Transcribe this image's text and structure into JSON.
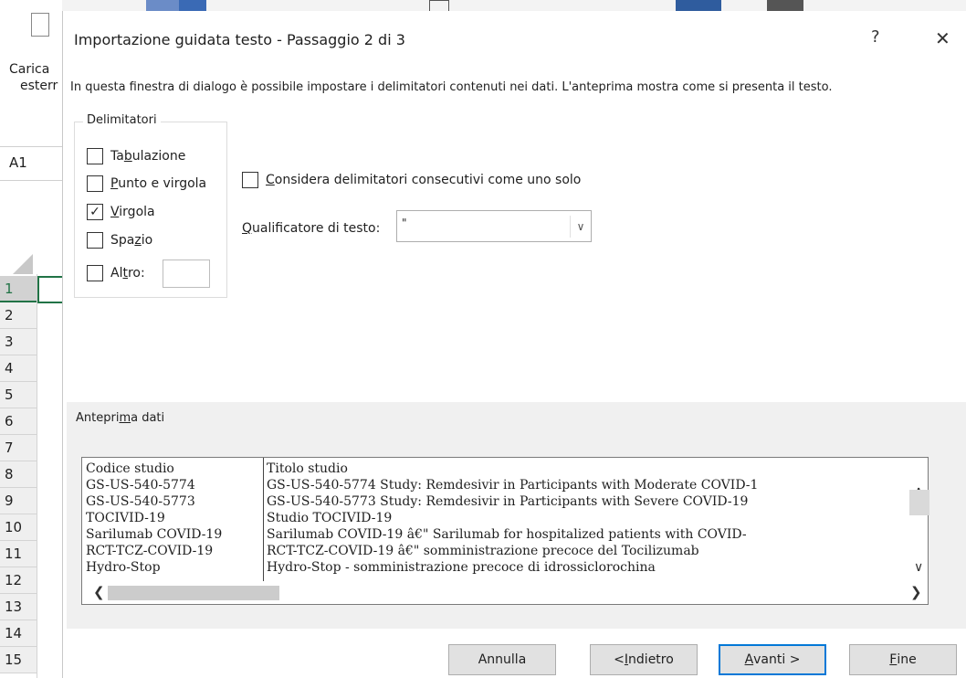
{
  "excel": {
    "left_text_1": "Carica",
    "left_text_2": "esterr",
    "name_box": "A1",
    "rows": [
      "1",
      "2",
      "3",
      "4",
      "5",
      "6",
      "7",
      "8",
      "9",
      "10",
      "11",
      "12",
      "13",
      "14",
      "15"
    ]
  },
  "dialog": {
    "title": "Importazione guidata testo - Passaggio 2 di 3",
    "help_glyph": "?",
    "close_glyph": "✕",
    "description": "In questa finestra di dialogo è possibile impostare i delimitatori contenuti nei dati. L'anteprima mostra come si presenta il testo."
  },
  "delimiters": {
    "legend": "Delimitatori",
    "items": [
      {
        "label_pre": "Ta",
        "label_acc": "b",
        "label_post": "ulazione",
        "checked": false
      },
      {
        "label_pre": "",
        "label_acc": "P",
        "label_post": "unto e virgola",
        "checked": false
      },
      {
        "label_pre": "",
        "label_acc": "V",
        "label_post": "irgola",
        "checked": true
      },
      {
        "label_pre": "Spa",
        "label_acc": "z",
        "label_post": "io",
        "checked": false
      },
      {
        "label_pre": "Al",
        "label_acc": "t",
        "label_post": "ro:",
        "checked": false
      }
    ],
    "altro_value": ""
  },
  "consecutive": {
    "label_acc": "C",
    "label_post": "onsidera delimitatori consecutivi come uno solo",
    "checked": false
  },
  "qualifier": {
    "label_acc": "Q",
    "label_post": "ualificatore di testo:",
    "value": "\""
  },
  "preview": {
    "legend_pre": "Antepri",
    "legend_acc": "m",
    "legend_post": "a dati",
    "rows": [
      {
        "c1": "Codice studio",
        "c2": "Titolo studio"
      },
      {
        "c1": "GS-US-540-5774",
        "c2": "GS-US-540-5774 Study: Remdesivir in Participants with Moderate COVID-1"
      },
      {
        "c1": "GS-US-540-5773",
        "c2": "GS-US-540-5773 Study: Remdesivir in Participants with Severe COVID-19"
      },
      {
        "c1": "TOCIVID-19",
        "c2": "Studio TOCIVID-19"
      },
      {
        "c1": "Sarilumab COVID-19",
        "c2": "Sarilumab COVID-19 â€\" Sarilumab for hospitalized patients with COVID-"
      },
      {
        "c1": "RCT-TCZ-COVID-19",
        "c2": "RCT-TCZ-COVID-19 â€\" somministrazione precoce del Tocilizumab"
      },
      {
        "c1": "Hydro-Stop",
        "c2": "Hydro-Stop - somministrazione precoce di idrossiclorochina"
      }
    ]
  },
  "buttons": {
    "cancel": "Annulla",
    "back_pre": "< ",
    "back_acc": "I",
    "back_post": "ndietro",
    "next_acc": "A",
    "next_post": "vanti >",
    "finish_acc": "F",
    "finish_post": "ine"
  }
}
